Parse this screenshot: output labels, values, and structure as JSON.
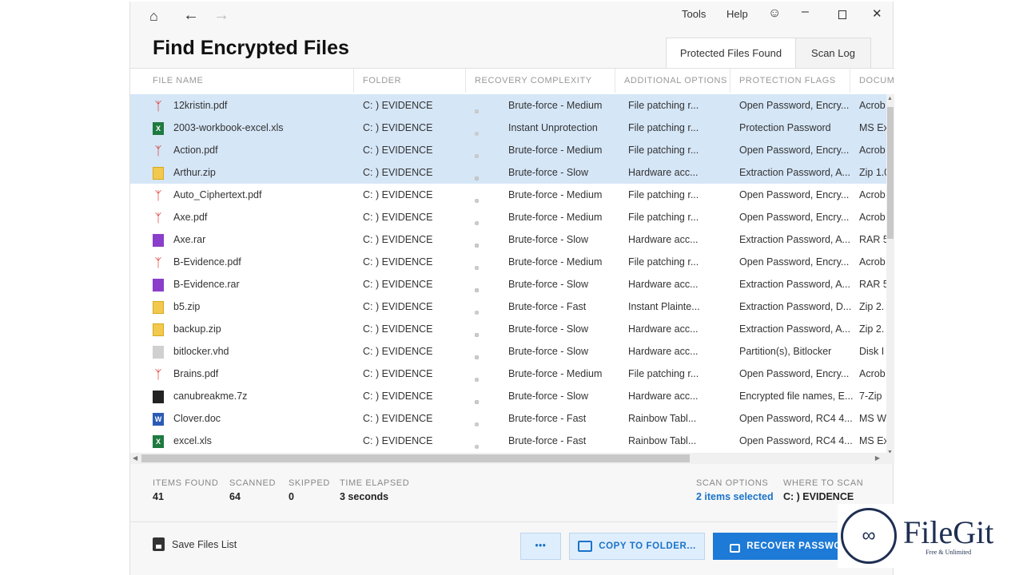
{
  "nav": {
    "tools": "Tools",
    "help": "Help"
  },
  "title": "Find Encrypted Files",
  "tabs": [
    "Protected Files Found",
    "Scan Log"
  ],
  "columns": [
    "FILE NAME",
    "FOLDER",
    "RECOVERY COMPLEXITY",
    "ADDITIONAL OPTIONS",
    "PROTECTION FLAGS",
    "DOCUME"
  ],
  "rows": [
    {
      "name": "12kristin.pdf",
      "type": "pdf",
      "folder": "C: ) EVIDENCE",
      "level": 3,
      "complexity": "Brute-force - Medium",
      "options": "File patching r...",
      "flags": "Open Password, Encry...",
      "doc": "Acrob",
      "selected": true
    },
    {
      "name": "2003-workbook-excel.xls",
      "type": "xls",
      "folder": "C: ) EVIDENCE",
      "level": 1,
      "complexity": "Instant Unprotection",
      "options": "File patching r...",
      "flags": "Protection Password",
      "doc": "MS Ex",
      "selected": true
    },
    {
      "name": "Action.pdf",
      "type": "pdf",
      "folder": "C: ) EVIDENCE",
      "level": 3,
      "complexity": "Brute-force - Medium",
      "options": "File patching r...",
      "flags": "Open Password, Encry...",
      "doc": "Acrob",
      "selected": true
    },
    {
      "name": "Arthur.zip",
      "type": "zip",
      "folder": "C: ) EVIDENCE",
      "level": 4,
      "complexity": "Brute-force - Slow",
      "options": "Hardware acc...",
      "flags": "Extraction Password, A...",
      "doc": "Zip 1.0",
      "selected": true
    },
    {
      "name": "Auto_Ciphertext.pdf",
      "type": "pdf",
      "folder": "C: ) EVIDENCE",
      "level": 3,
      "complexity": "Brute-force - Medium",
      "options": "File patching r...",
      "flags": "Open Password, Encry...",
      "doc": "Acrob",
      "selected": false
    },
    {
      "name": "Axe.pdf",
      "type": "pdf",
      "folder": "C: ) EVIDENCE",
      "level": 3,
      "complexity": "Brute-force - Medium",
      "options": "File patching r...",
      "flags": "Open Password, Encry...",
      "doc": "Acrob",
      "selected": false
    },
    {
      "name": "Axe.rar",
      "type": "rar",
      "folder": "C: ) EVIDENCE",
      "level": 4,
      "complexity": "Brute-force - Slow",
      "options": "Hardware acc...",
      "flags": "Extraction Password, A...",
      "doc": "RAR 5",
      "selected": false
    },
    {
      "name": "B-Evidence.pdf",
      "type": "pdf",
      "folder": "C: ) EVIDENCE",
      "level": 3,
      "complexity": "Brute-force - Medium",
      "options": "File patching r...",
      "flags": "Open Password, Encry...",
      "doc": "Acrob",
      "selected": false
    },
    {
      "name": "B-Evidence.rar",
      "type": "rar",
      "folder": "C: ) EVIDENCE",
      "level": 4,
      "complexity": "Brute-force - Slow",
      "options": "Hardware acc...",
      "flags": "Extraction Password, A...",
      "doc": "RAR 5",
      "selected": false
    },
    {
      "name": "b5.zip",
      "type": "zip",
      "folder": "C: ) EVIDENCE",
      "level": 2,
      "complexity": "Brute-force - Fast",
      "options": "Instant Plainte...",
      "flags": "Extraction Password, D...",
      "doc": "Zip 2.",
      "selected": false
    },
    {
      "name": "backup.zip",
      "type": "zip",
      "folder": "C: ) EVIDENCE",
      "level": 4,
      "complexity": "Brute-force - Slow",
      "options": "Hardware acc...",
      "flags": "Extraction Password, A...",
      "doc": "Zip 2.",
      "selected": false
    },
    {
      "name": "bitlocker.vhd",
      "type": "vhd",
      "folder": "C: ) EVIDENCE",
      "level": 4,
      "complexity": "Brute-force - Slow",
      "options": "Hardware acc...",
      "flags": "Partition(s), Bitlocker",
      "doc": "Disk I",
      "selected": false
    },
    {
      "name": "Brains.pdf",
      "type": "pdf",
      "folder": "C: ) EVIDENCE",
      "level": 3,
      "complexity": "Brute-force - Medium",
      "options": "File patching r...",
      "flags": "Open Password, Encry...",
      "doc": "Acrob",
      "selected": false
    },
    {
      "name": "canubreakme.7z",
      "type": "7z",
      "folder": "C: ) EVIDENCE",
      "level": 4,
      "complexity": "Brute-force - Slow",
      "options": "Hardware acc...",
      "flags": "Encrypted file names, E...",
      "doc": "7-Zip",
      "selected": false
    },
    {
      "name": "Clover.doc",
      "type": "doc",
      "folder": "C: ) EVIDENCE",
      "level": 2,
      "complexity": "Brute-force - Fast",
      "options": "Rainbow Tabl...",
      "flags": "Open Password, RC4 4...",
      "doc": "MS W",
      "selected": false
    },
    {
      "name": "excel.xls",
      "type": "xls",
      "folder": "C: ) EVIDENCE",
      "level": 2,
      "complexity": "Brute-force - Fast",
      "options": "Rainbow Tabl...",
      "flags": "Open Password, RC4 4...",
      "doc": "MS Ex",
      "selected": false
    }
  ],
  "stats": [
    {
      "label": "ITEMS FOUND",
      "value": "41"
    },
    {
      "label": "SCANNED",
      "value": "64"
    },
    {
      "label": "SKIPPED",
      "value": "0"
    },
    {
      "label": "TIME ELAPSED",
      "value": "3 seconds"
    }
  ],
  "scan_options": {
    "label": "SCAN OPTIONS",
    "value": "2 items selected"
  },
  "where": {
    "label": "WHERE TO SCAN",
    "value": "C: ) EVIDENCE"
  },
  "actions": {
    "save": "Save Files List",
    "more": "•••",
    "copy": "COPY TO FOLDER...",
    "recover": "RECOVER PASSWORD"
  },
  "watermark": {
    "brand": "FileGit",
    "tagline": "Free & Unlimited"
  },
  "colors": {
    "accent": "#1d7ad6",
    "selected": "#d5e6f7",
    "link": "#1a73c9"
  }
}
